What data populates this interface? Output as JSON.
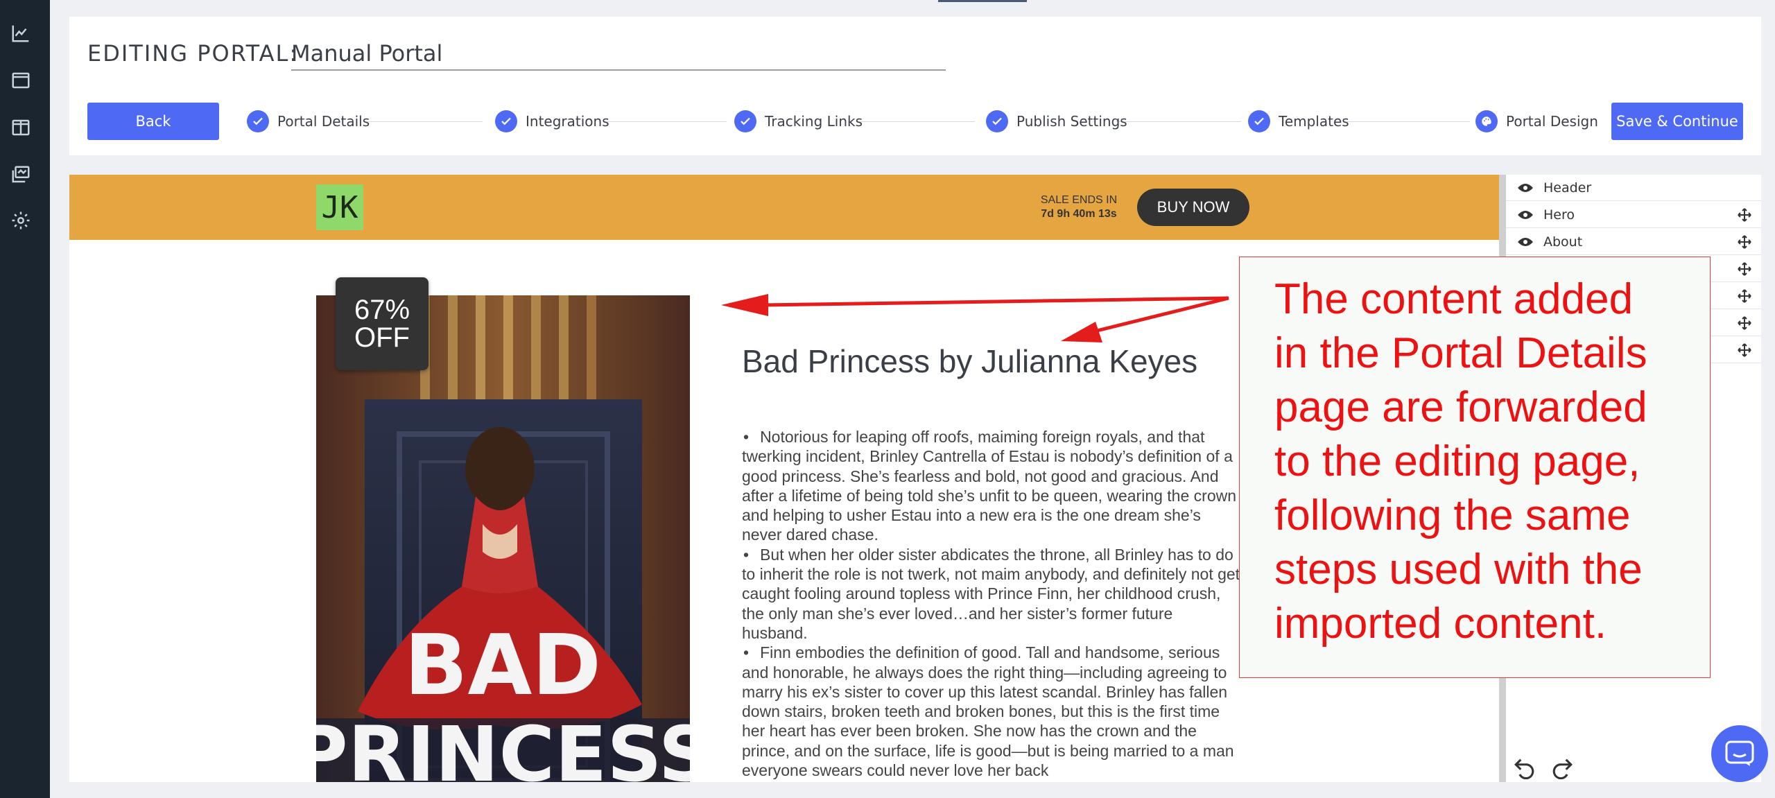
{
  "header": {
    "title_prefix": "EDITING PORTAL:",
    "portal_name": "Manual Portal",
    "back_label": "Back",
    "save_label": "Save & Continue"
  },
  "steps": [
    {
      "label": "Portal Details",
      "status": "complete"
    },
    {
      "label": "Integrations",
      "status": "complete"
    },
    {
      "label": "Tracking Links",
      "status": "complete"
    },
    {
      "label": "Publish Settings",
      "status": "complete"
    },
    {
      "label": "Templates",
      "status": "complete"
    },
    {
      "label": "Portal Design",
      "status": "current"
    }
  ],
  "sidebar": {
    "icons": [
      "chart-icon",
      "browser-icon",
      "layout-icon",
      "library-icon",
      "gear-icon"
    ]
  },
  "site": {
    "logo_text": "JK",
    "sale_label": "SALE ENDS IN",
    "countdown": "7d 9h 40m 13s",
    "buy_label": "BUY NOW",
    "discount": "67%\nOFF",
    "cover_title": "BAD\nPRINCESS",
    "book_title": "Bad Princess by Julianna Keyes",
    "description": [
      "Notorious for leaping off roofs, maiming foreign royals, and that twerking incident, Brinley Cantrella of Estau is nobody’s definition of a good princess. She’s fearless and bold, not good and gracious. And after a lifetime of being told she’s unfit to be queen, wearing the crown and helping to usher Estau into a new era is the one dream she’s never dared chase.",
      "But when her older sister abdicates the throne, all Brinley has to do to inherit the role is not twerk, not maim anybody, and definitely not get caught fooling around topless with Prince Finn, her childhood crush, the only man she’s ever loved…and her sister’s former future husband.",
      "Finn embodies the definition of good. Tall and handsome, serious and honorable, he always does the right thing—including agreeing to marry his ex’s sister to cover up this latest scandal. Brinley has fallen down stairs, broken teeth and broken bones, but this is the first time her heart has ever been broken. She now has the crown and the prince, and on the surface, life is good—but is being married to a man everyone swears could never love her back"
    ]
  },
  "sections": [
    {
      "label": "Header",
      "movable": false
    },
    {
      "label": "Hero",
      "movable": true
    },
    {
      "label": "About",
      "movable": true
    },
    {
      "label": "",
      "movable": true
    },
    {
      "label": "",
      "movable": true
    },
    {
      "label": "",
      "movable": true
    },
    {
      "label": "",
      "movable": true
    }
  ],
  "annotation": {
    "text": "The content added in the Portal Details page are forwarded to the editing page, following the same steps used with the imported content."
  },
  "colors": {
    "accent": "#4e6af5",
    "header_bg": "#e5a641",
    "sidebar_bg": "#1a2530",
    "annotation": "#ee1111"
  }
}
